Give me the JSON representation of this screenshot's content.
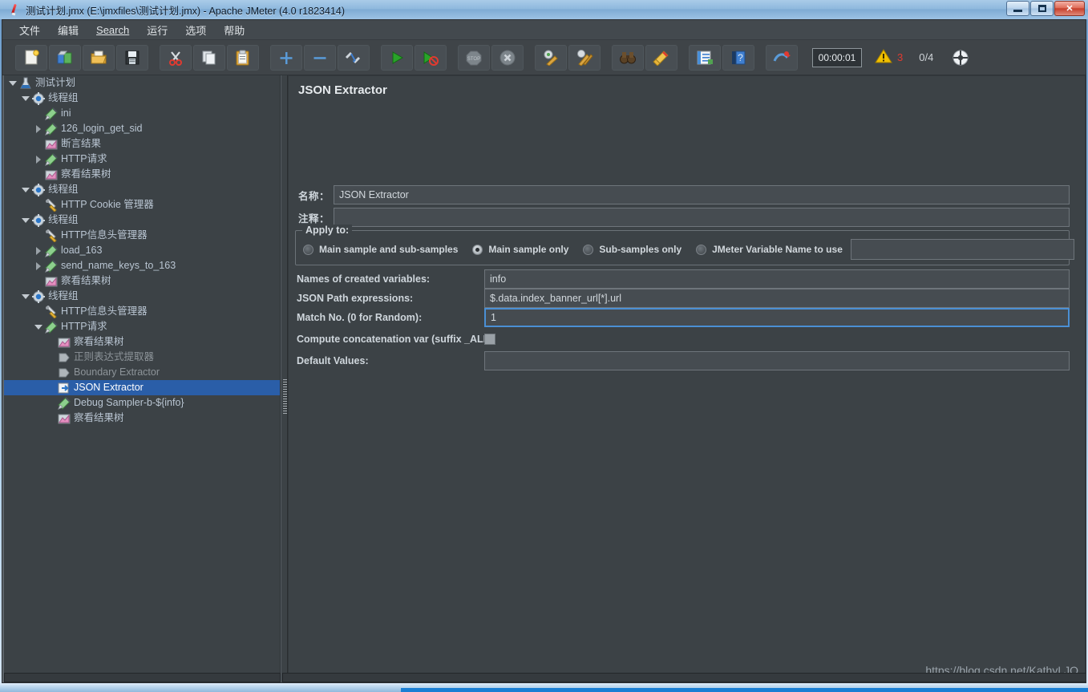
{
  "window": {
    "title": "测试计划.jmx (E:\\jmxfiles\\测试计划.jmx) - Apache JMeter (4.0 r1823414)",
    "icon": "jmeter-feather-icon",
    "minimize_label": "",
    "maximize_label": "",
    "close_label": "✕"
  },
  "menubar": {
    "items": [
      {
        "label": "文件",
        "name": "menu-file"
      },
      {
        "label": "编辑",
        "name": "menu-edit"
      },
      {
        "label": "Search",
        "name": "menu-search",
        "mnemonic": "S"
      },
      {
        "label": "运行",
        "name": "menu-run"
      },
      {
        "label": "选项",
        "name": "menu-options"
      },
      {
        "label": "帮助",
        "name": "menu-help"
      }
    ]
  },
  "toolbar": {
    "buttons": [
      {
        "icon": "new-document-icon",
        "name": "toolbar-new"
      },
      {
        "icon": "templates-icon",
        "name": "toolbar-templates"
      },
      {
        "icon": "open-folder-icon",
        "name": "toolbar-open"
      },
      {
        "icon": "save-floppy-icon",
        "name": "toolbar-save"
      },
      {
        "icon": "cut-scissors-icon",
        "name": "toolbar-cut"
      },
      {
        "icon": "copy-pages-icon",
        "name": "toolbar-copy"
      },
      {
        "icon": "paste-clipboard-icon",
        "name": "toolbar-paste"
      },
      {
        "icon": "plus-expand-icon",
        "name": "toolbar-expand-all"
      },
      {
        "icon": "minus-collapse-icon",
        "name": "toolbar-collapse-all"
      },
      {
        "icon": "toggle-element-icon",
        "name": "toolbar-toggle"
      },
      {
        "icon": "play-green-icon",
        "name": "toolbar-start"
      },
      {
        "icon": "play-no-timers-icon",
        "name": "toolbar-start-no-pauses"
      },
      {
        "icon": "stop-octagon-icon",
        "name": "toolbar-stop"
      },
      {
        "icon": "shutdown-x-icon",
        "name": "toolbar-shutdown"
      },
      {
        "icon": "clear-broom-icon",
        "name": "toolbar-clear"
      },
      {
        "icon": "clear-all-broom-icon",
        "name": "toolbar-clear-all"
      },
      {
        "icon": "binoculars-search-icon",
        "name": "toolbar-search"
      },
      {
        "icon": "broom-reset-icon",
        "name": "toolbar-reset-search"
      },
      {
        "icon": "function-helper-icon",
        "name": "toolbar-function-helper"
      },
      {
        "icon": "help-book-icon",
        "name": "toolbar-help"
      },
      {
        "icon": "undo-redo-icon",
        "name": "toolbar-undo"
      }
    ],
    "timer": "00:00:01",
    "warning_icon": "warning-triangle-icon",
    "warning_count": "3",
    "thread_count": "0/4",
    "remote_icon": "remote-globe-icon"
  },
  "tree": {
    "nodes": [
      {
        "label": "测试计划",
        "indent": 0,
        "toggle": "down",
        "icon": "test-plan-icon",
        "selected": false,
        "dim": false
      },
      {
        "label": "线程组",
        "indent": 1,
        "toggle": "down",
        "icon": "thread-group-icon",
        "selected": false,
        "dim": false
      },
      {
        "label": "ini",
        "indent": 2,
        "toggle": "none",
        "icon": "sampler-icon",
        "selected": false,
        "dim": false
      },
      {
        "label": "126_login_get_sid",
        "indent": 2,
        "toggle": "right",
        "icon": "sampler-icon",
        "selected": false,
        "dim": false
      },
      {
        "label": "断言结果",
        "indent": 2,
        "toggle": "none",
        "icon": "listener-icon",
        "selected": false,
        "dim": false
      },
      {
        "label": "HTTP请求",
        "indent": 2,
        "toggle": "right",
        "icon": "sampler-icon",
        "selected": false,
        "dim": false
      },
      {
        "label": "察看结果树",
        "indent": 2,
        "toggle": "none",
        "icon": "listener-icon",
        "selected": false,
        "dim": false
      },
      {
        "label": "线程组",
        "indent": 1,
        "toggle": "down",
        "icon": "thread-group-icon",
        "selected": false,
        "dim": false
      },
      {
        "label": "HTTP Cookie 管理器",
        "indent": 2,
        "toggle": "none",
        "icon": "config-wrench-icon",
        "selected": false,
        "dim": false
      },
      {
        "label": "线程组",
        "indent": 1,
        "toggle": "down",
        "icon": "thread-group-icon",
        "selected": false,
        "dim": false
      },
      {
        "label": "HTTP信息头管理器",
        "indent": 2,
        "toggle": "none",
        "icon": "config-wrench-icon",
        "selected": false,
        "dim": false
      },
      {
        "label": "load_163",
        "indent": 2,
        "toggle": "right",
        "icon": "sampler-icon",
        "selected": false,
        "dim": false
      },
      {
        "label": "send_name_keys_to_163",
        "indent": 2,
        "toggle": "right",
        "icon": "sampler-icon",
        "selected": false,
        "dim": false
      },
      {
        "label": "察看结果树",
        "indent": 2,
        "toggle": "none",
        "icon": "listener-icon",
        "selected": false,
        "dim": false
      },
      {
        "label": "线程组",
        "indent": 1,
        "toggle": "down",
        "icon": "thread-group-icon",
        "selected": false,
        "dim": false
      },
      {
        "label": "HTTP信息头管理器",
        "indent": 2,
        "toggle": "none",
        "icon": "config-wrench-icon",
        "selected": false,
        "dim": false
      },
      {
        "label": "HTTP请求",
        "indent": 2,
        "toggle": "down",
        "icon": "sampler-icon",
        "selected": false,
        "dim": false
      },
      {
        "label": "察看结果树",
        "indent": 3,
        "toggle": "none",
        "icon": "listener-icon",
        "selected": false,
        "dim": false
      },
      {
        "label": "正则表达式提取器",
        "indent": 3,
        "toggle": "none",
        "icon": "post-processor-icon",
        "selected": false,
        "dim": true
      },
      {
        "label": "Boundary Extractor",
        "indent": 3,
        "toggle": "none",
        "icon": "post-processor-icon",
        "selected": false,
        "dim": true
      },
      {
        "label": "JSON Extractor",
        "indent": 3,
        "toggle": "none",
        "icon": "json-extractor-icon",
        "selected": true,
        "dim": false
      },
      {
        "label": "Debug Sampler-b-${info}",
        "indent": 3,
        "toggle": "none",
        "icon": "sampler-icon",
        "selected": false,
        "dim": false
      },
      {
        "label": "察看结果树",
        "indent": 3,
        "toggle": "none",
        "icon": "listener-icon",
        "selected": false,
        "dim": false
      }
    ]
  },
  "panel": {
    "title": "JSON Extractor",
    "name_label": "名称：",
    "name_value": "JSON Extractor",
    "comment_label": "注释：",
    "comment_value": "",
    "apply_to": {
      "legend": "Apply to:",
      "options": [
        {
          "label": "Main sample and sub-samples",
          "selected": false,
          "name": "radio-main-and-sub"
        },
        {
          "label": "Main sample only",
          "selected": true,
          "name": "radio-main-only"
        },
        {
          "label": "Sub-samples only",
          "selected": false,
          "name": "radio-sub-only"
        },
        {
          "label": "JMeter Variable Name to use",
          "selected": false,
          "name": "radio-jmeter-variable"
        }
      ],
      "variable_value": ""
    },
    "fields": [
      {
        "label": "Names of created variables:",
        "value": "info",
        "name": "names-of-created-variables",
        "focused": false
      },
      {
        "label": "JSON Path expressions:",
        "value": "$.data.index_banner_url[*].url",
        "name": "json-path-expressions",
        "focused": false
      },
      {
        "label": "Match No. (0 for Random):",
        "value": "1",
        "name": "match-no",
        "focused": true
      },
      {
        "label": "Default Values:",
        "value": "",
        "name": "default-values",
        "focused": false
      }
    ],
    "concat_label": "Compute concatenation var (suffix _ALL):",
    "concat_checked": false,
    "watermark": "https://blog.csdn.net/KathyLJQ"
  }
}
